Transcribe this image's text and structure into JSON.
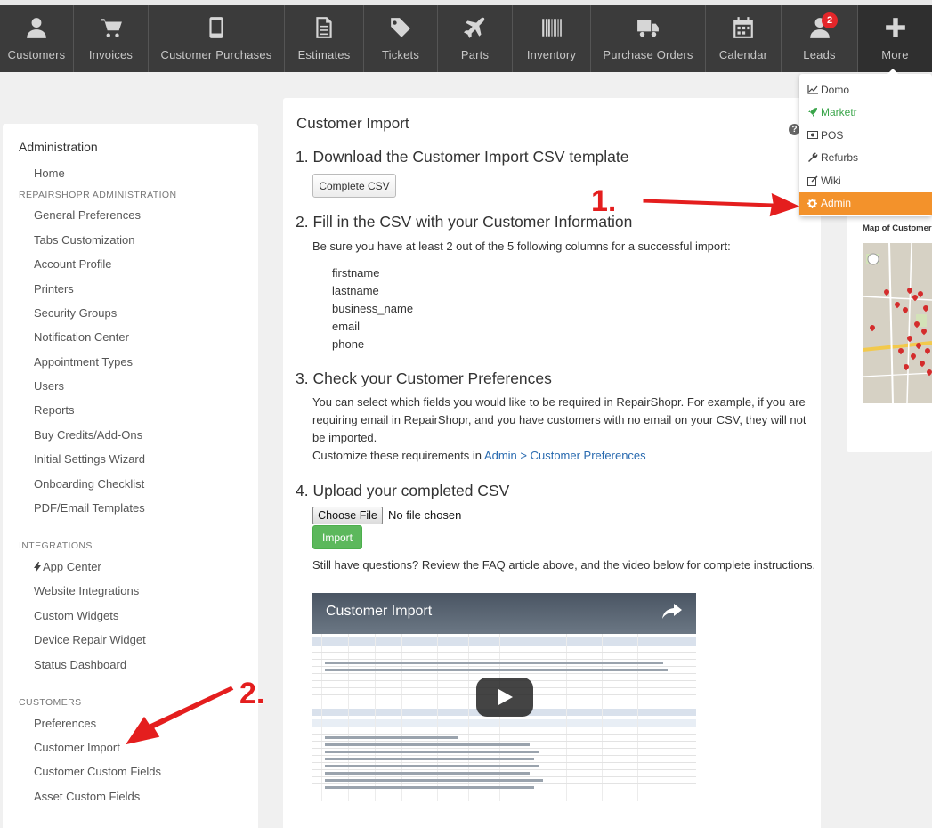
{
  "nav": {
    "items": [
      {
        "label": "Customers",
        "icon": "user-icon"
      },
      {
        "label": "Invoices",
        "icon": "cart-icon"
      },
      {
        "label": "Customer Purchases",
        "icon": "phone-icon"
      },
      {
        "label": "Estimates",
        "icon": "document-icon"
      },
      {
        "label": "Tickets",
        "icon": "tag-icon"
      },
      {
        "label": "Parts",
        "icon": "plane-icon"
      },
      {
        "label": "Inventory",
        "icon": "barcode-icon"
      },
      {
        "label": "Purchase Orders",
        "icon": "truck-icon"
      },
      {
        "label": "Calendar",
        "icon": "calendar-icon"
      },
      {
        "label": "Leads",
        "icon": "user-icon",
        "badge": "2"
      },
      {
        "label": "More",
        "icon": "plus-icon"
      }
    ]
  },
  "dropdown": {
    "items": [
      {
        "label": "Domo",
        "icon": "chart-icon"
      },
      {
        "label": "Marketr",
        "icon": "rocket-icon"
      },
      {
        "label": "POS",
        "icon": "money-icon"
      },
      {
        "label": "Refurbs",
        "icon": "wrench-icon"
      },
      {
        "label": "Wiki",
        "icon": "edit-icon"
      },
      {
        "label": "Admin",
        "icon": "gear-icon"
      }
    ]
  },
  "sidebar": {
    "title": "Administration",
    "home": "Home",
    "sections": [
      {
        "heading": "REPAIRSHOPR ADMINISTRATION",
        "links": [
          "General Preferences",
          "Tabs Customization",
          "Account Profile",
          "Printers",
          "Security Groups",
          "Notification Center",
          "Appointment Types",
          "Users",
          "Reports",
          "Buy Credits/Add-Ons",
          "Initial Settings Wizard",
          "Onboarding Checklist",
          "PDF/Email Templates"
        ]
      },
      {
        "heading": "INTEGRATIONS",
        "links": [
          "App Center",
          "Website Integrations",
          "Custom Widgets",
          "Device Repair Widget",
          "Status Dashboard"
        ]
      },
      {
        "heading": "CUSTOMERS",
        "links": [
          "Preferences",
          "Customer Import",
          "Customer Custom Fields",
          "Asset Custom Fields"
        ]
      }
    ]
  },
  "main": {
    "title": "Customer Import",
    "help": "?",
    "step1": "1. Download the Customer Import CSV template",
    "complete_csv": "Complete CSV",
    "step2": "2. Fill in the CSV with your Customer Information",
    "step2_text": "Be sure you have at least 2 out of the 5 following columns for a successful import:",
    "columns": [
      "firstname",
      "lastname",
      "business_name",
      "email",
      "phone"
    ],
    "step3": "3. Check your Customer Preferences",
    "step3_line1": "You can select which fields you would like to be required in RepairShopr. For example, if you are",
    "step3_line2": "requiring email in RepairShopr, and you have customers with no email on your CSV, they will not",
    "step3_line3": "be imported.",
    "step3_customize": "Customize these requirements in ",
    "step3_link": "Admin > Customer Preferences",
    "step4": "4. Upload your completed CSV",
    "choose_file": "Choose File",
    "no_file": "No file chosen",
    "import": "Import",
    "questions": "Still have questions? Review the FAQ article above, and the video below for complete instructions.",
    "video_title": "Customer Import"
  },
  "right_panel": {
    "map_title": "Map of Customers"
  },
  "annotations": {
    "one": "1.",
    "two": "2."
  },
  "colors": {
    "nav_bg": "#3b3b3b",
    "admin_highlight": "#f3922b",
    "import_button": "#5cb85c",
    "link": "#2a6bb0",
    "annotation": "#e41e1e"
  }
}
